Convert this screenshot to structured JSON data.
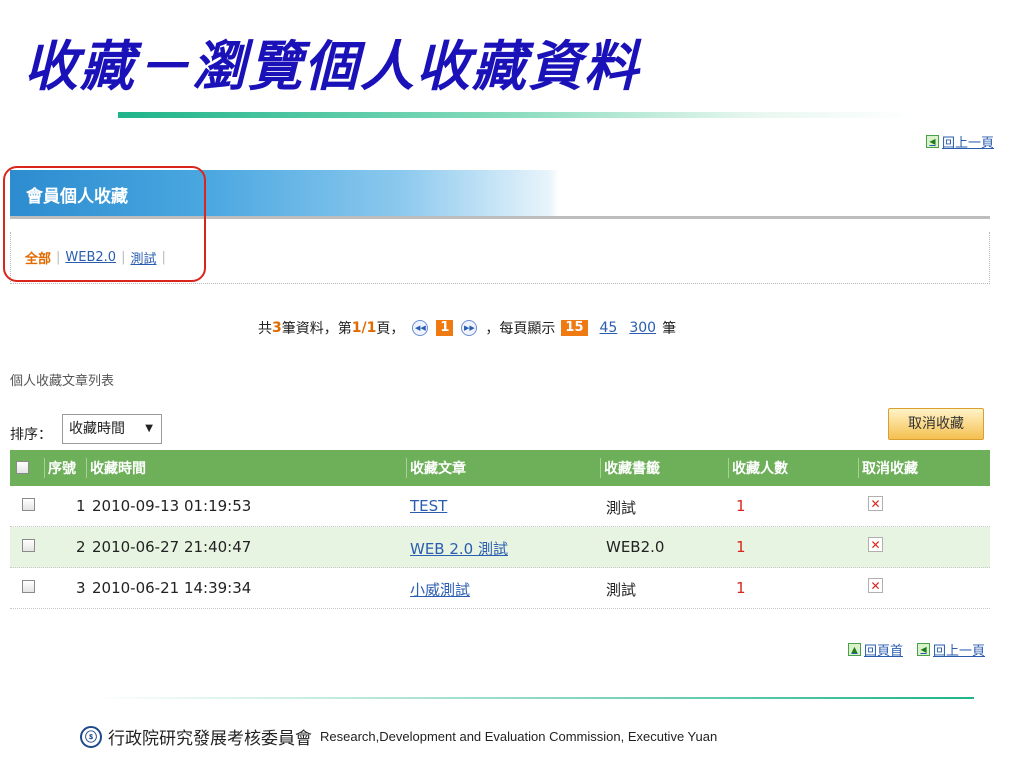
{
  "slide": {
    "title": "收藏－瀏覽個人收藏資料"
  },
  "top_nav": {
    "back_label": "回上一頁"
  },
  "member": {
    "title": "會員個人收藏",
    "tags": [
      {
        "label": "全部",
        "active": true
      },
      {
        "label": "WEB2.0",
        "active": false
      },
      {
        "label": "測試",
        "active": false
      }
    ]
  },
  "pagination": {
    "prefix": "共",
    "total": "3",
    "mid": "筆資料，第",
    "page": "1/1",
    "suffix": "頁，",
    "current_page": "1",
    "per_page_label": "，每頁顯示",
    "per_page_options": [
      "15",
      "45",
      "300"
    ],
    "per_page_selected": "15",
    "unit": "筆"
  },
  "list": {
    "label": "個人收藏文章列表",
    "sort_label": "排序：",
    "sort_value": "收藏時間",
    "cancel_button": "取消收藏"
  },
  "table": {
    "headers": {
      "index": "序號",
      "time": "收藏時間",
      "article": "收藏文章",
      "tag": "收藏書籤",
      "count": "收藏人數",
      "cancel": "取消收藏"
    },
    "rows": [
      {
        "index": "1",
        "time": "2010-09-13 01:19:53",
        "article": "TEST",
        "tag": "測試",
        "count": "1"
      },
      {
        "index": "2",
        "time": "2010-06-27 21:40:47",
        "article": "WEB 2.0 測試",
        "tag": "WEB2.0",
        "count": "1"
      },
      {
        "index": "3",
        "time": "2010-06-21 14:39:34",
        "article": "小威測試",
        "tag": "測試",
        "count": "1"
      }
    ]
  },
  "bottom_nav": {
    "home_label": "回頁首",
    "back_label": "回上一頁"
  },
  "footer": {
    "org_zh": "行政院研究發展考核委員會",
    "org_en": "Research,Development and Evaluation Commission, Executive Yuan"
  },
  "colors": {
    "title_blue": "#1a12b8",
    "header_green": "#6eaf5a",
    "accent_orange": "#e06a00",
    "highlight_red": "#d9251c"
  }
}
